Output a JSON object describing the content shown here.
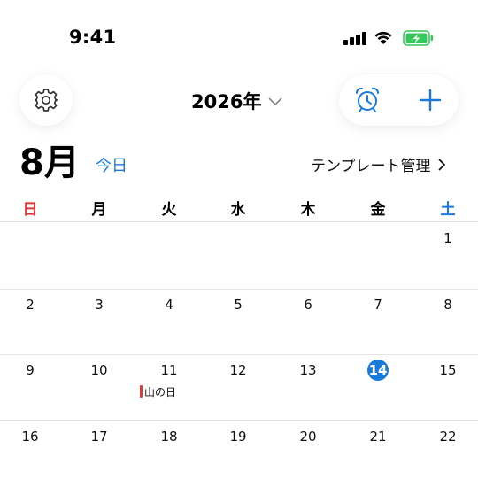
{
  "status_bar": {
    "time": "9:41"
  },
  "header": {
    "settings_icon": "gear-icon",
    "year_label": "2026年",
    "alarm_icon": "alarm-clock-icon",
    "add_icon": "plus-icon"
  },
  "month_bar": {
    "month_label": "8月",
    "today_label": "今日",
    "template_label": "テンプレート管理"
  },
  "weekdays": [
    "日",
    "月",
    "火",
    "水",
    "木",
    "金",
    "土"
  ],
  "weeks": [
    [
      "",
      "",
      "",
      "",
      "",
      "",
      "1"
    ],
    [
      "2",
      "3",
      "4",
      "5",
      "6",
      "7",
      "8"
    ],
    [
      "9",
      "10",
      "11",
      "12",
      "13",
      "14",
      "15"
    ],
    [
      "16",
      "17",
      "18",
      "19",
      "20",
      "21",
      "22"
    ]
  ],
  "today": "14",
  "events": {
    "holiday_11": "山の日"
  },
  "colors": {
    "accent": "#1a7ad9",
    "sunday": "#e03a3a",
    "battery": "#34c759"
  }
}
